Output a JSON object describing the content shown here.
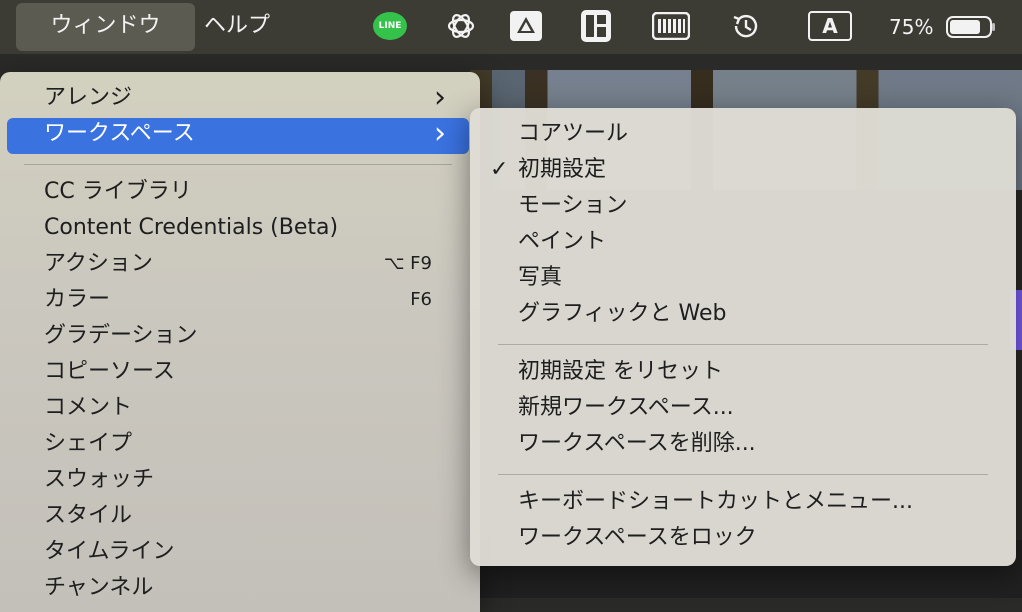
{
  "menubar": {
    "window": "ウィンドウ",
    "help": "ヘルプ",
    "line_icon_text": "LINE",
    "input_source": "A",
    "battery": "75%"
  },
  "main_menu": {
    "items": [
      {
        "label": "アレンジ",
        "submenu": true
      },
      {
        "label": "ワークスペース",
        "submenu": true,
        "highlighted": true
      },
      {
        "label": "CC ライブラリ"
      },
      {
        "label": "Content Credentials (Beta)"
      },
      {
        "label": "アクション",
        "shortcut": "⌥ F9"
      },
      {
        "label": "カラー",
        "shortcut": "F6"
      },
      {
        "label": "グラデーション"
      },
      {
        "label": "コピーソース"
      },
      {
        "label": "コメント"
      },
      {
        "label": "シェイプ"
      },
      {
        "label": "スウォッチ"
      },
      {
        "label": "スタイル"
      },
      {
        "label": "タイムライン"
      },
      {
        "label": "チャンネル"
      }
    ],
    "chevron": "›"
  },
  "sub_menu": {
    "checkmark": "✓",
    "items": [
      {
        "label": "コアツール"
      },
      {
        "label": "初期設定",
        "checked": true
      },
      {
        "label": "モーション"
      },
      {
        "label": "ペイント"
      },
      {
        "label": "写真"
      },
      {
        "label": "グラフィックと Web"
      },
      {
        "label": "初期設定 をリセット"
      },
      {
        "label": "新規ワークスペース..."
      },
      {
        "label": "ワークスペースを削除..."
      },
      {
        "label": "キーボードショートカットとメニュー..."
      },
      {
        "label": "ワークスペースをロック"
      }
    ]
  },
  "colors": {
    "highlight": "#3a72e0",
    "line_green": "#35c24a"
  },
  "icons": [
    "line-icon",
    "chatgpt-icon",
    "google-drive-icon",
    "layout-icon",
    "keyboard-icon",
    "time-machine-icon",
    "input-source-icon",
    "battery-icon",
    "checkmark-icon",
    "chevron-right-icon"
  ]
}
